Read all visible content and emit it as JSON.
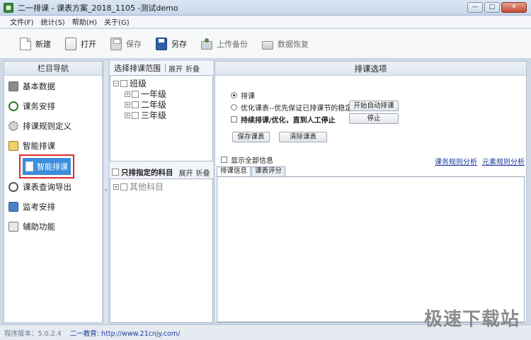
{
  "window": {
    "title": "二一排课 - 课表方案_2018_1105 -测试demo",
    "minimize": "—",
    "maximize": "□",
    "close": "✕"
  },
  "menu": [
    "文件(F)",
    "统计(S)",
    "帮助(H)",
    "关于(G)"
  ],
  "toolbar": [
    {
      "label": "新建",
      "icon": "new-doc-icon",
      "enabled": true
    },
    {
      "label": "打开",
      "icon": "open-folder-icon",
      "enabled": true
    },
    {
      "label": "保存",
      "icon": "save-disk-icon",
      "enabled": false
    },
    {
      "label": "另存",
      "icon": "save-as-disk-icon",
      "enabled": true
    },
    {
      "label": "上传备份",
      "icon": "upload-backup-icon",
      "enabled": false
    },
    {
      "label": "数据恢复",
      "icon": "restore-data-icon",
      "enabled": false
    }
  ],
  "sidebar": {
    "title": "栏目导航",
    "items": [
      {
        "label": "基本数据",
        "icon": "database-icon"
      },
      {
        "label": "课务安排",
        "icon": "clock-icon"
      },
      {
        "label": "排课规则定义",
        "icon": "gear-icon"
      },
      {
        "label": "智能排课",
        "icon": "pencil-icon"
      }
    ],
    "selected_sub": "智能排课",
    "items_after": [
      {
        "label": "课表查询导出",
        "icon": "search-icon"
      },
      {
        "label": "监考安排",
        "icon": "monitor-icon"
      },
      {
        "label": "辅助功能",
        "icon": "tools-icon"
      }
    ]
  },
  "range_panel": {
    "title": "选择排课范围",
    "expand": "展开",
    "collapse": "折叠",
    "tree_root": "班级",
    "tree_children": [
      "一年级",
      "二年级",
      "三年级"
    ]
  },
  "subject_panel": {
    "only_specified": "只排指定的科目",
    "expand": "展开",
    "collapse": "折叠",
    "tree_root": "其他科目"
  },
  "options_panel": {
    "title": "排课选项",
    "radio_schedule": "排课",
    "radio_optimize": "优化课表--优先保证已排课节的稳定",
    "checkbox_continuous": "持续排课/优化，直到人工停止",
    "btn_start_auto": "开始自动排课",
    "btn_stop": "停止",
    "btn_save_table": "保存课表",
    "btn_clear_table": "清除课表",
    "show_all_info": "显示全部信息",
    "link_course_rule": "课务规则分析",
    "link_element_rule": "元素规则分析",
    "tab_schedule_info": "排课信息",
    "tab_table_score": "课表评分"
  },
  "status": {
    "version": "程序版本：5.0.2.4",
    "edu": "二一教育: http://www.21cnjy.com/"
  },
  "watermark": "极速下载站"
}
